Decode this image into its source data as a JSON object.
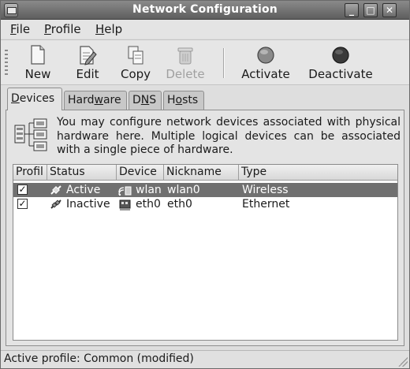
{
  "window": {
    "title": "Network Configuration",
    "controls": {
      "minimize": "_",
      "maximize": "□",
      "close": "✕"
    }
  },
  "menubar": {
    "file": {
      "mnemonic": "F",
      "rest": "ile"
    },
    "profile": {
      "mnemonic": "P",
      "rest": "rofile"
    },
    "help": {
      "mnemonic": "H",
      "rest": "elp"
    }
  },
  "toolbar": {
    "new": {
      "label": "New",
      "icon": "new-document-icon",
      "enabled": true
    },
    "edit": {
      "label": "Edit",
      "icon": "edit-document-icon",
      "enabled": true
    },
    "copy": {
      "label": "Copy",
      "icon": "copy-icon",
      "enabled": true
    },
    "delete": {
      "label": "Delete",
      "icon": "trash-icon",
      "enabled": false
    },
    "activate": {
      "label": "Activate",
      "icon": "activate-circle-icon",
      "enabled": true
    },
    "deactivate": {
      "label": "Deactivate",
      "icon": "deactivate-circle-icon",
      "enabled": true
    }
  },
  "tabs": {
    "devices": {
      "pre": "",
      "mnemonic": "D",
      "post": "evices",
      "active": true
    },
    "hardware": {
      "pre": "Hard",
      "mnemonic": "w",
      "post": "are",
      "active": false
    },
    "dns": {
      "pre": "D",
      "mnemonic": "N",
      "post": "S",
      "active": false
    },
    "hosts": {
      "pre": "H",
      "mnemonic": "o",
      "post": "sts",
      "active": false
    }
  },
  "devices_panel": {
    "info_text": "You may configure network devices associated with physical hardware here. Multiple logical devices can be associated with a single piece of hardware.",
    "columns": {
      "profile": "Profil",
      "status": "Status",
      "device": "Device",
      "nickname": "Nickname",
      "type": "Type"
    },
    "rows": [
      {
        "checked": "✓",
        "status": "Active",
        "device": "wlan",
        "nickname": "wlan0",
        "type": "Wireless",
        "selected": true
      },
      {
        "checked": "✓",
        "status": "Inactive",
        "device": "eth0",
        "nickname": "eth0",
        "type": "Ethernet",
        "selected": false
      }
    ]
  },
  "statusbar": {
    "text": "Active profile: Common (modified)"
  },
  "colors": {
    "selection": "#707070",
    "titlebar": "#6e6e6e"
  }
}
